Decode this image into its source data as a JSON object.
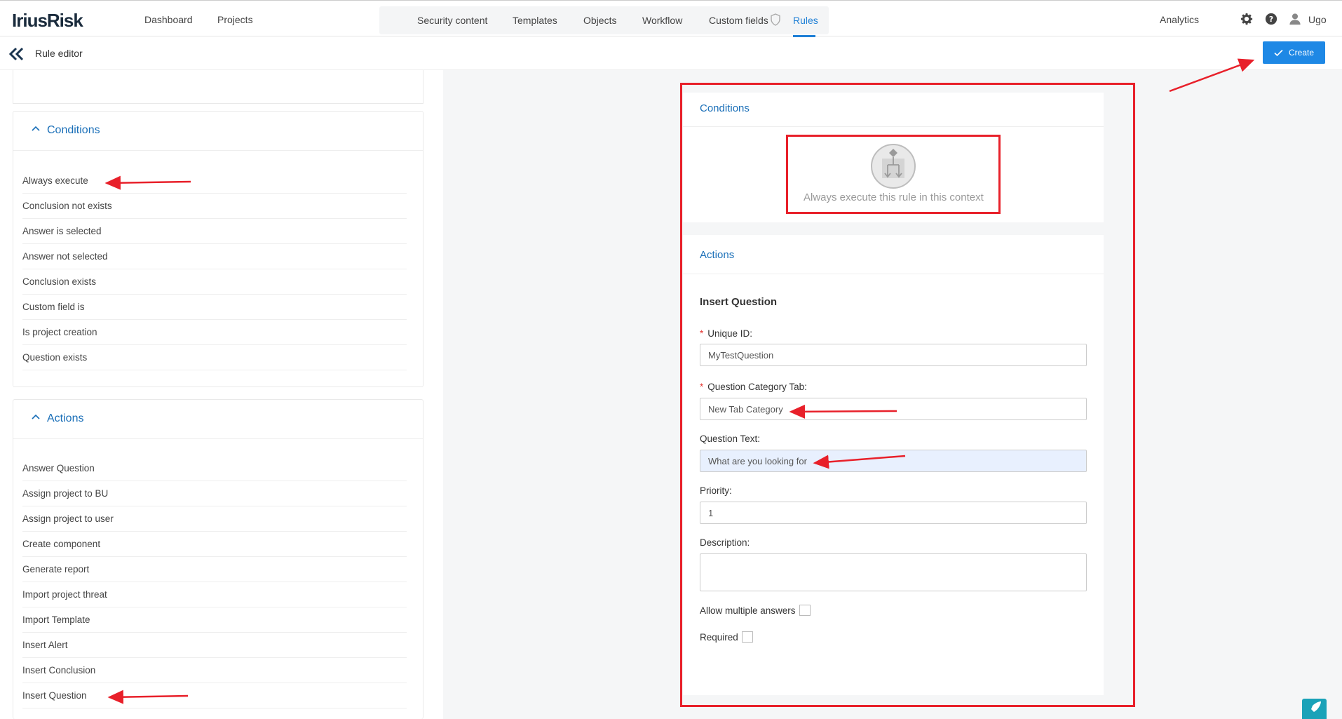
{
  "app": {
    "logo": "IriusRisk"
  },
  "topnav": {
    "dashboard": "Dashboard",
    "projects": "Projects",
    "security_content": "Security content",
    "templates": "Templates",
    "objects": "Objects",
    "workflow": "Workflow",
    "custom_fields": "Custom fields",
    "rules": "Rules",
    "analytics": "Analytics",
    "user": "Ugo"
  },
  "subheader": {
    "title": "Rule editor",
    "create_label": "Create"
  },
  "left": {
    "conditions": {
      "title": "Conditions",
      "items": [
        "Always execute",
        "Conclusion not exists",
        "Answer is selected",
        "Answer not selected",
        "Conclusion exists",
        "Custom field is",
        "Is project creation",
        "Question exists"
      ]
    },
    "actions": {
      "title": "Actions",
      "items": [
        "Answer Question",
        "Assign project to BU",
        "Assign project to user",
        "Create component",
        "Generate report",
        "Import project threat",
        "Import Template",
        "Insert Alert",
        "Insert Conclusion",
        "Insert Question"
      ]
    }
  },
  "main": {
    "conditions_title": "Conditions",
    "condition_text": "Always execute this rule in this context",
    "actions_title": "Actions",
    "action_title": "Insert Question",
    "fields": {
      "unique_id_label": "Unique ID:",
      "unique_id_value": "MyTestQuestion",
      "category_label": "Question Category Tab:",
      "category_value": "New Tab Category",
      "question_text_label": "Question Text:",
      "question_text_value": "What are you looking for",
      "priority_label": "Priority:",
      "priority_value": "1",
      "description_label": "Description:",
      "description_value": "",
      "allow_multiple_label": "Allow multiple answers",
      "required_label": "Required",
      "required_marker": "*"
    }
  },
  "colors": {
    "accent": "#1e88e5",
    "link": "#1a6fb8",
    "annotation": "#e8202a"
  }
}
